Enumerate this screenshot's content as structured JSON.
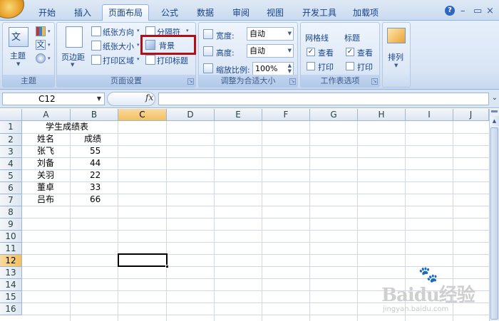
{
  "ribbon_tabs": [
    "开始",
    "插入",
    "页面布局",
    "公式",
    "数据",
    "审阅",
    "视图",
    "开发工具",
    "加载项"
  ],
  "active_tab": "页面布局",
  "window_controls": {
    "help": "?",
    "minimize": "–",
    "restore": "▭",
    "close": "×"
  },
  "groups": {
    "theme": {
      "label": "主题",
      "theme_button": "主题",
      "colors": "colors-icon",
      "fonts_glyph": "文",
      "effects": "effects-icon"
    },
    "page_setup": {
      "label": "页面设置",
      "margins": "页边距",
      "orientation": "纸张方向",
      "size": "纸张大小",
      "print_area": "打印区域",
      "breaks": "分隔符",
      "background": "背景",
      "print_titles": "打印标题"
    },
    "scale_to_fit": {
      "label": "调整为合适大小",
      "width_label": "宽度:",
      "width_value": "自动",
      "height_label": "高度:",
      "height_value": "自动",
      "scale_label": "缩放比例:",
      "scale_value": "100%"
    },
    "sheet_options": {
      "label": "工作表选项",
      "gridlines": "网格线",
      "headings": "标题",
      "view": "查看",
      "print": "打印",
      "gridlines_view": true,
      "gridlines_print": false,
      "headings_view": true,
      "headings_print": false
    },
    "arrange": {
      "label": "排列"
    }
  },
  "formula_bar": {
    "name_box": "C12",
    "fx": "fx",
    "formula": ""
  },
  "columns": [
    "A",
    "B",
    "C",
    "D",
    "E",
    "F",
    "G",
    "H",
    "I",
    "J"
  ],
  "rows": [
    "1",
    "2",
    "3",
    "4",
    "5",
    "6",
    "7",
    "8",
    "9",
    "10",
    "11",
    "12",
    "13",
    "14",
    "15",
    "16"
  ],
  "selected_cell": "C12",
  "sheet": {
    "title": "学生成绩表",
    "header": [
      "姓名",
      "成绩"
    ],
    "records": [
      {
        "name": "张飞",
        "score": "55"
      },
      {
        "name": "刘备",
        "score": "44"
      },
      {
        "name": "关羽",
        "score": "22"
      },
      {
        "name": "董卓",
        "score": "33"
      },
      {
        "name": "吕布",
        "score": "66"
      }
    ]
  },
  "watermark": {
    "brand": "Baidu经验",
    "url": "jingyan.baidu.com"
  }
}
